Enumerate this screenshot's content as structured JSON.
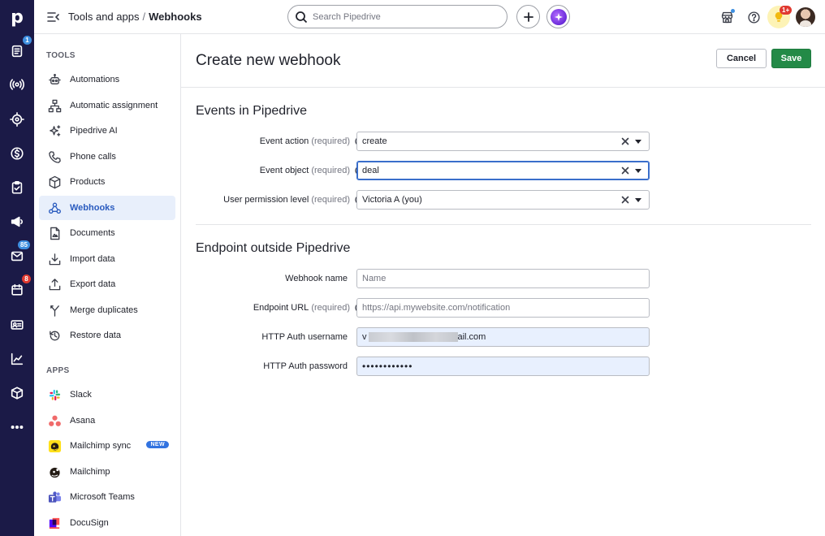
{
  "app": {
    "logo": "p"
  },
  "rail": {
    "badges": {
      "deals": "1",
      "mail": "85",
      "calendar": "8"
    }
  },
  "topbar": {
    "breadcrumb_parent": "Tools and apps",
    "breadcrumb_separator": "/",
    "breadcrumb_current": "Webhooks",
    "search_placeholder": "Search Pipedrive",
    "notifications_badge": "1+"
  },
  "sidebar": {
    "tools_label": "TOOLS",
    "tools": [
      {
        "label": "Automations",
        "icon": "robot-icon"
      },
      {
        "label": "Automatic assignment",
        "icon": "hierarchy-icon"
      },
      {
        "label": "Pipedrive AI",
        "icon": "sparkle-icon"
      },
      {
        "label": "Phone calls",
        "icon": "phone-icon"
      },
      {
        "label": "Products",
        "icon": "box-icon"
      },
      {
        "label": "Webhooks",
        "icon": "webhook-icon",
        "active": true
      },
      {
        "label": "Documents",
        "icon": "document-icon"
      },
      {
        "label": "Import data",
        "icon": "import-icon"
      },
      {
        "label": "Export data",
        "icon": "export-icon"
      },
      {
        "label": "Merge duplicates",
        "icon": "merge-icon"
      },
      {
        "label": "Restore data",
        "icon": "restore-icon"
      }
    ],
    "apps_label": "APPS",
    "apps": [
      {
        "label": "Slack",
        "icon": "slack-icon"
      },
      {
        "label": "Asana",
        "icon": "asana-icon"
      },
      {
        "label": "Mailchimp sync",
        "icon": "mailchimp-icon",
        "badge": "NEW"
      },
      {
        "label": "Mailchimp",
        "icon": "mailchimp-icon"
      },
      {
        "label": "Microsoft Teams",
        "icon": "teams-icon"
      },
      {
        "label": "DocuSign",
        "icon": "docusign-icon"
      }
    ]
  },
  "main": {
    "title": "Create new webhook",
    "cancel_label": "Cancel",
    "save_label": "Save",
    "events_section": {
      "title": "Events in Pipedrive",
      "event_action_label": "Event action",
      "event_action_required": "(required)",
      "event_action_value": "create",
      "event_object_label": "Event object",
      "event_object_required": "(required)",
      "event_object_value": "deal",
      "permission_label": "User permission level",
      "permission_required": "(required)",
      "permission_value": "Victoria A (you)"
    },
    "endpoint_section": {
      "title": "Endpoint outside Pipedrive",
      "webhook_name_label": "Webhook name",
      "webhook_name_placeholder": "Name",
      "endpoint_url_label": "Endpoint URL",
      "endpoint_url_required": "(required)",
      "endpoint_url_placeholder": "https://api.mywebsite.com/notification",
      "username_label": "HTTP Auth username",
      "username_prefix": "v",
      "username_suffix": "ail.com",
      "password_label": "HTTP Auth password",
      "password_value": "••••••••••••"
    }
  },
  "colors": {
    "rail": "#1b1a47",
    "accent": "#2a5bbf",
    "save": "#238a47"
  }
}
